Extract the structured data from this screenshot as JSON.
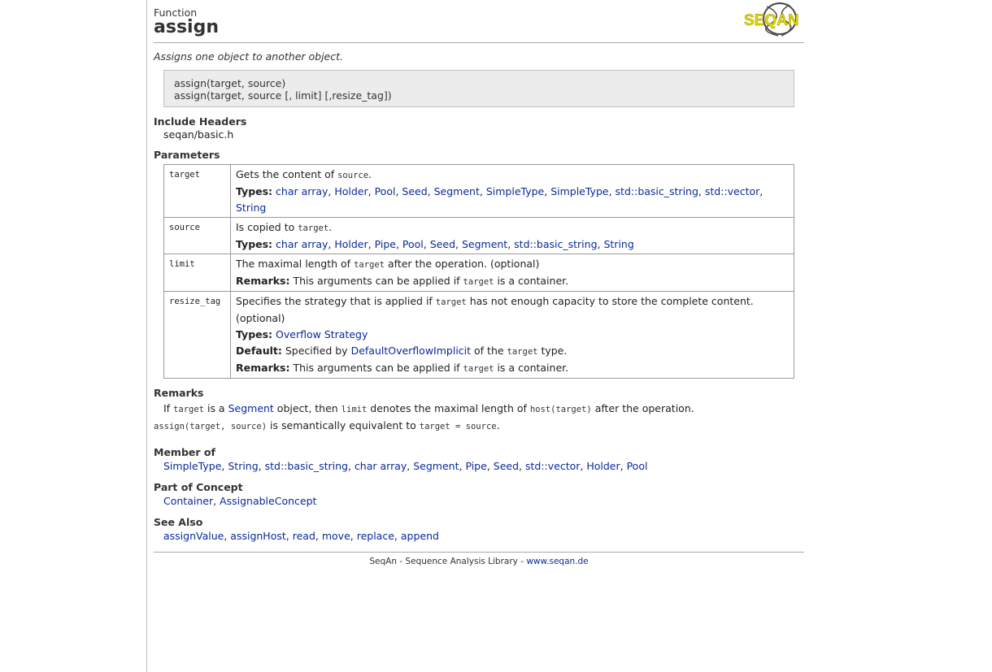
{
  "header": {
    "kind": "Function",
    "title": "assign",
    "logo_text": "SEQAN"
  },
  "summary": "Assigns one object to another object.",
  "signatures": [
    "assign(target, source)",
    "assign(target, source [, limit] [,resize_tag])"
  ],
  "labels": {
    "include": "Include Headers",
    "parameters": "Parameters",
    "remarks": "Remarks",
    "member_of": "Member of",
    "part_of_concept": "Part of Concept",
    "see_also": "See Also",
    "types": "Types:",
    "remarks_inline": "Remarks:",
    "default": "Default:"
  },
  "include_header": "seqan/basic.h",
  "params": [
    {
      "name": "target",
      "d1": "Gets the content of ",
      "d1c": "source",
      "d1e": ".",
      "types": [
        "char array",
        "Holder",
        "Pool",
        "Seed",
        "Segment",
        "SimpleType",
        "SimpleType",
        "std::basic_string",
        "std::vector",
        "String"
      ]
    },
    {
      "name": "source",
      "d1": "Is copied to ",
      "d1c": "target",
      "d1e": ".",
      "types": [
        "char array",
        "Holder",
        "Pipe",
        "Pool",
        "Seed",
        "Segment",
        "std::basic_string",
        "String"
      ]
    },
    {
      "name": "limit",
      "d1": "The maximal length of ",
      "d1c": "target",
      "d1e": " after the operation. (optional)",
      "r1": "This arguments can be applied if ",
      "rc": "target",
      "r2": " is a container."
    },
    {
      "name": "resize_tag",
      "d1": "Specifies the strategy that is applied if ",
      "d1c": "target",
      "d1e": " has not enough capacity to store the complete content. (optional)",
      "types_link": "Overflow Strategy",
      "def1": "Specified by ",
      "def_link": "DefaultOverflowImplicit",
      "def2": " of the ",
      "def_code": "target",
      "def3": " type.",
      "r1": "This arguments can be applied if ",
      "rc": "target",
      "r2": " is a container."
    }
  ],
  "remarks_body": {
    "l1a": "If ",
    "l1b": "target",
    "l1c": " is a ",
    "l1link": "Segment",
    "l1d": " object, then ",
    "l1e": "limit",
    "l1f": " denotes the maximal length of ",
    "l1g": "host(target)",
    "l1h": " after the operation.",
    "l2a": "assign(target, source)",
    "l2b": " is semantically equivalent to ",
    "l2c": "target = source",
    "l2d": "."
  },
  "member_of": [
    "SimpleType",
    "String",
    "std::basic_string",
    "char array",
    "Segment",
    "Pipe",
    "Seed",
    "std::vector",
    "Holder",
    "Pool"
  ],
  "part_of_concept": [
    "Container",
    "AssignableConcept"
  ],
  "see_also": [
    "assignValue",
    "assignHost",
    "read",
    "move",
    "replace",
    "append"
  ],
  "footer": {
    "text": "SeqAn - Sequence Analysis Library - ",
    "link": "www.seqan.de"
  },
  "colors": {
    "link": "#0a2a9a",
    "logo_yellow": "#e6d800",
    "sig_bg": "#ececec"
  }
}
